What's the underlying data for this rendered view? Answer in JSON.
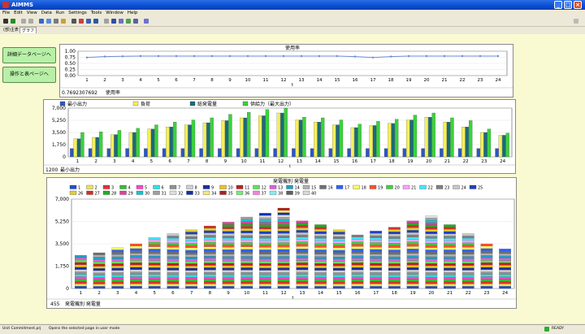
{
  "app": {
    "title": "AIMMS"
  },
  "menu": [
    "File",
    "Edit",
    "View",
    "Data",
    "Run",
    "Settings",
    "Tools",
    "Window",
    "Help"
  ],
  "tabs": [
    "(部)主表",
    "グラフ"
  ],
  "sidebar": {
    "btn_detail": "詳細データページへ",
    "btn_operation": "操作と表ページへ"
  },
  "status": {
    "left": "Unit Commitment.prj",
    "message": "Opens the selected page in user mode",
    "ready": "READY"
  },
  "colors": {
    "line": "#6f8bd6",
    "bar_blue": "#2d55c6",
    "bar_yellow": "#f4f058",
    "bar_teal": "#1a6b78",
    "bar_green": "#3ad33a"
  },
  "chart_data": [
    {
      "type": "line",
      "title": "使用率",
      "x": [
        1,
        2,
        3,
        4,
        5,
        6,
        7,
        8,
        9,
        10,
        11,
        12,
        13,
        14,
        15,
        16,
        17,
        18,
        19,
        20,
        21,
        22,
        23,
        24
      ],
      "xlabel": "t",
      "series": [
        {
          "name": "使用率",
          "values": [
            0.74,
            0.78,
            0.79,
            0.8,
            0.8,
            0.8,
            0.8,
            0.8,
            0.8,
            0.8,
            0.8,
            0.8,
            0.8,
            0.8,
            0.8,
            0.78,
            0.74,
            0.78,
            0.8,
            0.8,
            0.8,
            0.8,
            0.8,
            0.8
          ]
        }
      ],
      "yticks": [
        "0.00",
        "0.25",
        "0.50",
        "0.75",
        "1.00"
      ],
      "ylim": [
        0,
        1
      ],
      "footer_value": "0.7692307692",
      "footer_label": "使用率"
    },
    {
      "type": "bar",
      "x": [
        1,
        2,
        3,
        4,
        5,
        6,
        7,
        8,
        9,
        10,
        11,
        12,
        13,
        14,
        15,
        16,
        17,
        18,
        19,
        20,
        21,
        22,
        23,
        24
      ],
      "xlabel": "t",
      "ylim": [
        0,
        7000
      ],
      "yticks": [
        "0",
        "1,750",
        "3,500",
        "5,250",
        "7,000"
      ],
      "legend": [
        "最小出力",
        "負荷",
        "総発電量",
        "供給力（最大出力）"
      ],
      "series": [
        {
          "name": "最小出力",
          "values": [
            1200,
            1200,
            1200,
            1200,
            1200,
            1200,
            1200,
            1200,
            1200,
            1200,
            1200,
            1200,
            1200,
            1200,
            1200,
            1200,
            1200,
            1200,
            1200,
            1200,
            1200,
            1200,
            1200,
            1200
          ]
        },
        {
          "name": "負荷",
          "values": [
            2600,
            2800,
            3200,
            3500,
            4000,
            4300,
            4600,
            4900,
            5200,
            5600,
            5900,
            6300,
            5300,
            5000,
            4600,
            4200,
            4500,
            4800,
            5300,
            5700,
            5000,
            4300,
            3500,
            3100
          ]
        },
        {
          "name": "総発電量",
          "values": [
            2600,
            2800,
            3200,
            3500,
            4000,
            4300,
            4600,
            4900,
            5200,
            5600,
            5900,
            6300,
            5300,
            5000,
            4600,
            4200,
            4500,
            4800,
            5300,
            5700,
            5000,
            4300,
            3500,
            3100
          ]
        },
        {
          "name": "供給力（最大出力）",
          "values": [
            3500,
            3600,
            3800,
            4100,
            4600,
            5000,
            5300,
            5600,
            6100,
            6400,
            6800,
            7000,
            5700,
            5600,
            5300,
            4700,
            5100,
            5400,
            6000,
            6300,
            5600,
            5200,
            4000,
            3400
          ]
        }
      ],
      "footer_value": "1200",
      "footer_label": "最小出力"
    },
    {
      "type": "bar",
      "stacked": true,
      "title": "発電機別 発電量",
      "x": [
        1,
        2,
        3,
        4,
        5,
        6,
        7,
        8,
        9,
        10,
        11,
        12,
        13,
        14,
        15,
        16,
        17,
        18,
        19,
        20,
        21,
        22,
        23,
        24
      ],
      "xlabel": "t",
      "ylim": [
        0,
        7000
      ],
      "yticks": [
        "0",
        "1,750",
        "3,500",
        "5,250",
        "7,000"
      ],
      "totals": [
        2600,
        2800,
        3200,
        3500,
        4000,
        4300,
        4600,
        4900,
        5200,
        5600,
        5900,
        6300,
        5300,
        5000,
        4600,
        4200,
        4500,
        4800,
        5300,
        5700,
        5000,
        4300,
        3500,
        3100
      ],
      "legend": [
        "1",
        "2",
        "3",
        "4",
        "5",
        "6",
        "7",
        "8",
        "9",
        "10",
        "11",
        "12",
        "13",
        "14",
        "15",
        "16",
        "17",
        "18",
        "19",
        "20",
        "21",
        "22",
        "23",
        "24",
        "25",
        "26",
        "27",
        "28",
        "29",
        "30",
        "31",
        "32",
        "33",
        "34",
        "35",
        "36",
        "37",
        "38",
        "39",
        "40"
      ],
      "legend_colors": [
        "#1f4fd8",
        "#f7e14a",
        "#e23030",
        "#2ec02e",
        "#ff44cc",
        "#30e0e0",
        "#909090",
        "#d0d0d0",
        "#1a2fa0",
        "#f0c020",
        "#c02020",
        "#60e060",
        "#e060e0",
        "#20a0c0",
        "#b0b0b0",
        "#707070",
        "#3060ff",
        "#ffff60",
        "#ff5030",
        "#40d040",
        "#ffa0ff",
        "#40e8ff",
        "#808080",
        "#c8c8c8",
        "#2040c0",
        "#e0d030",
        "#d03030",
        "#20b020",
        "#e040a0",
        "#10c8d0",
        "#a0a0a0",
        "#e0e0e0",
        "#1030b0",
        "#f8e870",
        "#b02020",
        "#70f070",
        "#ff80e0",
        "#80f0ff",
        "#606060",
        "#d8d8d8"
      ],
      "footer_value": "455",
      "footer_label": "発電機別 発電量"
    }
  ]
}
